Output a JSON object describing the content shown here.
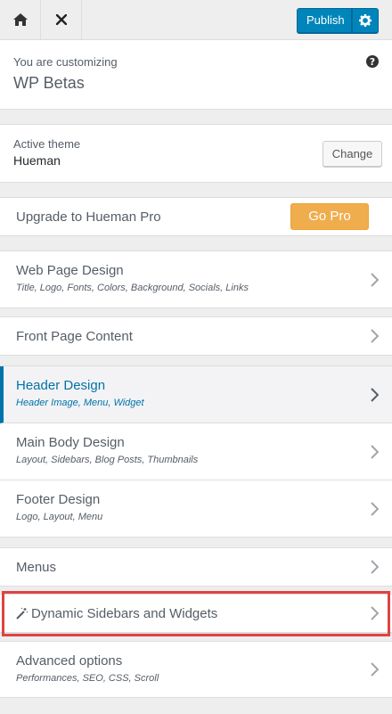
{
  "topbar": {
    "home_icon": "home-icon",
    "close_icon": "close-icon",
    "publish_label": "Publish",
    "publish_settings_icon": "gear-icon"
  },
  "info": {
    "customizing_label": "You are customizing",
    "site_name": "WP Betas",
    "help_icon": "help-icon"
  },
  "theme": {
    "label": "Active theme",
    "name": "Hueman",
    "change_label": "Change"
  },
  "upgrade": {
    "label": "Upgrade to Hueman Pro",
    "button_label": "Go Pro"
  },
  "sections": {
    "web_page_design": {
      "title": "Web Page Design",
      "sub": "Title, Logo, Fonts, Colors, Background, Socials, Links"
    },
    "front_page_content": {
      "title": "Front Page Content"
    },
    "header_design": {
      "title": "Header Design",
      "sub": "Header Image, Menu, Widget"
    },
    "main_body_design": {
      "title": "Main Body Design",
      "sub": "Layout, Sidebars, Blog Posts, Thumbnails"
    },
    "footer_design": {
      "title": "Footer Design",
      "sub": "Logo, Layout, Menu"
    },
    "menus": {
      "title": "Menus"
    },
    "dynamic_sidebars": {
      "title": "Dynamic Sidebars and Widgets",
      "icon": "magic-wand-icon"
    },
    "advanced_options": {
      "title": "Advanced options",
      "sub": "Performances, SEO, CSS, Scroll"
    }
  },
  "colors": {
    "accent": "#0085ba",
    "active": "#0073aa",
    "gopro": "#f0ad4e",
    "highlight": "#e04343"
  }
}
